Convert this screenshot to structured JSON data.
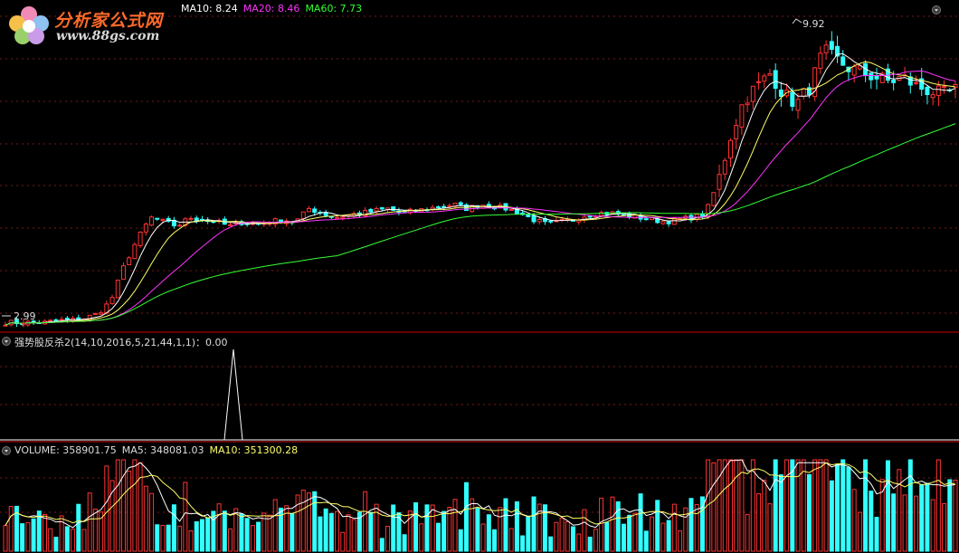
{
  "logo": {
    "title": "分析家公式网",
    "url": "www.88gs.com"
  },
  "price_panel": {
    "ma_legend": [
      {
        "label": "MA10: 8.24",
        "color": "#ffffff"
      },
      {
        "label": "MA20: 8.46",
        "color": "#ff33ff"
      },
      {
        "label": "MA60: 7.73",
        "color": "#33ff33"
      }
    ],
    "high_marker": "9.92",
    "low_marker": "2.99"
  },
  "indicator_panel": {
    "title": "强势股反杀2(14,10,2016,5,21,44,1,1)：0.00"
  },
  "volume_panel": {
    "legend": [
      {
        "label": "VOLUME: 358901.75",
        "color": "#dddddd"
      },
      {
        "label": "MA5: 348081.03",
        "color": "#dddddd"
      },
      {
        "label": "MA10: 351300.28",
        "color": "#ffff66"
      }
    ]
  },
  "colors": {
    "up": "#ff3333",
    "down": "#33ffff",
    "ma_short": "#ffffff",
    "ma10": "#ffff66",
    "ma20": "#ff33ff",
    "ma60": "#33ff33",
    "separator": "#cc0000"
  },
  "chart_data": {
    "type": "candlestick",
    "close_path": [
      3.0,
      3.0,
      3.0,
      3.0,
      3.05,
      3.05,
      3.1,
      3.2,
      3.5,
      4.3,
      4.9,
      5.4,
      5.3,
      5.2,
      5.4,
      5.35,
      5.3,
      5.2,
      5.3,
      5.25,
      5.3,
      5.35,
      5.3,
      5.6,
      5.5,
      5.4,
      5.45,
      5.5,
      5.55,
      5.6,
      5.5,
      5.55,
      5.6,
      5.65,
      5.7,
      5.6,
      5.7,
      5.65,
      5.6,
      5.5,
      5.35,
      5.25,
      5.3,
      5.35,
      5.45,
      5.5,
      5.5,
      5.45,
      5.4,
      5.35,
      5.3,
      5.35,
      5.4,
      5.45,
      6.2,
      7.3,
      8.1,
      8.4,
      8.7,
      8.2,
      8.0,
      8.4,
      9.2,
      9.0,
      8.8,
      8.7,
      8.6,
      8.5,
      8.6,
      8.4,
      8.3,
      8.2,
      8.3
    ],
    "high_value": 9.92,
    "low_value": 2.99,
    "indicator_spike_value": 1.0
  }
}
